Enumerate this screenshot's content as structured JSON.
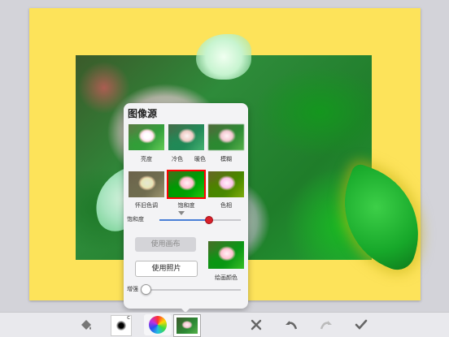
{
  "popover": {
    "title": "图像源",
    "filters": [
      {
        "label": "亮度",
        "selected": false
      },
      {
        "label": "冷色",
        "selected": false
      },
      {
        "label": "暖色",
        "selected": false
      },
      {
        "label": "模糊",
        "selected": false
      },
      {
        "label": "怀旧色调",
        "selected": false
      },
      {
        "label": "饱和度",
        "selected": true
      },
      {
        "label": "色相",
        "selected": false
      }
    ],
    "saturation_slider": {
      "label": "饱和度",
      "value": 0.6
    },
    "use_canvas_button": "使用画布",
    "use_photo_button": "使用照片",
    "painting_color_label": "绘画颜色",
    "enhance_slider": {
      "label": "增强",
      "value": 0.0
    }
  },
  "toolbar": {
    "icons": [
      "paint-bucket-icon",
      "brush-preview-icon",
      "color-wheel-icon",
      "photo-source-icon",
      "close-icon",
      "undo-icon",
      "redo-icon",
      "check-icon"
    ],
    "brush_size_mark": "c"
  },
  "colors": {
    "canvas_background": "#fde35a",
    "selected_outline": "#d02020",
    "slider_knob": "#d8202a"
  }
}
